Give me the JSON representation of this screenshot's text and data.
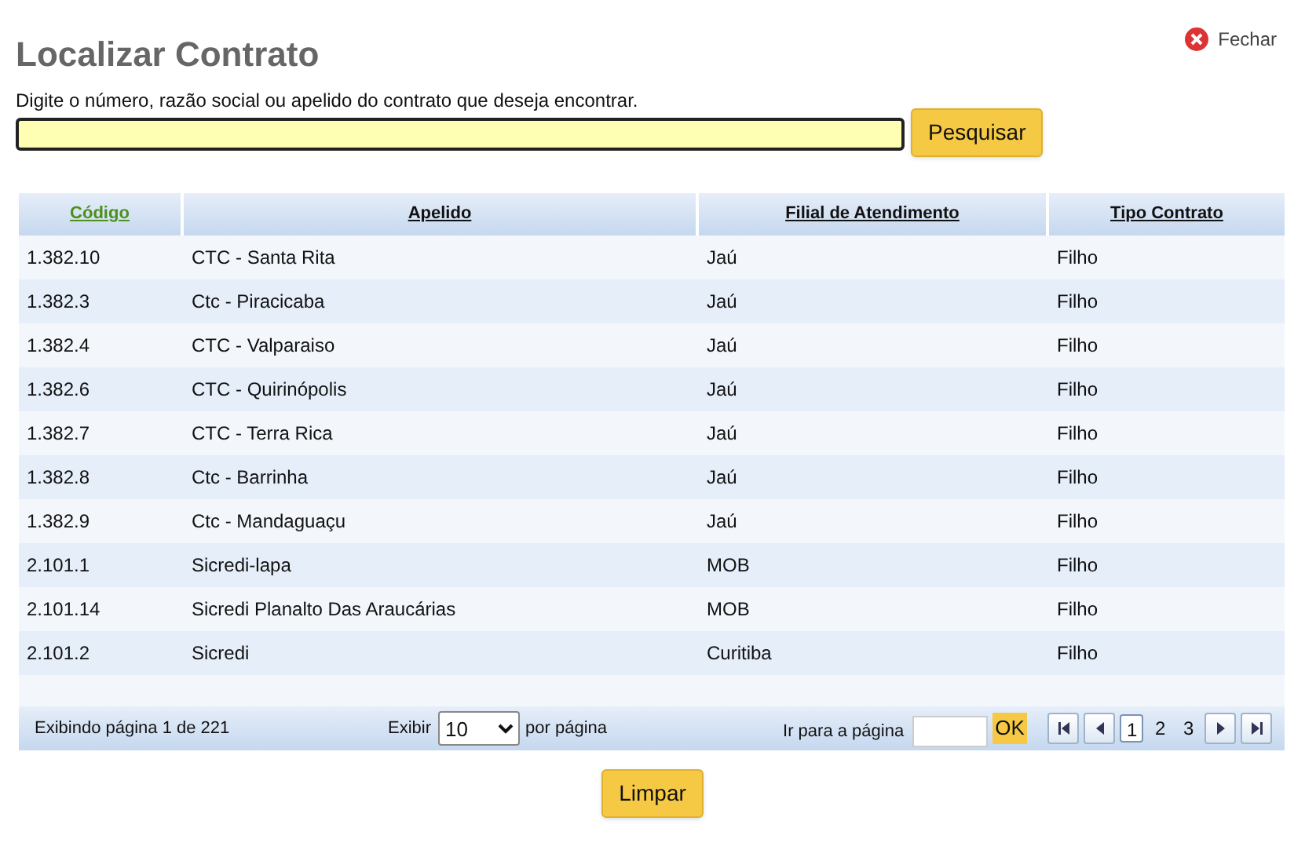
{
  "close": {
    "label": "Fechar"
  },
  "title": "Localizar Contrato",
  "search": {
    "label": "Digite o número, razão social ou apelido do contrato que deseja encontrar.",
    "button": "Pesquisar"
  },
  "table": {
    "columns": [
      {
        "label": "Código",
        "sorted": true
      },
      {
        "label": "Apelido",
        "sorted": false
      },
      {
        "label": "Filial de Atendimento",
        "sorted": false
      },
      {
        "label": "Tipo Contrato",
        "sorted": false
      }
    ],
    "rows": [
      [
        "1.382.10",
        "CTC - Santa Rita",
        "Jaú",
        "Filho"
      ],
      [
        "1.382.3",
        "Ctc - Piracicaba",
        "Jaú",
        "Filho"
      ],
      [
        "1.382.4",
        "CTC - Valparaiso",
        "Jaú",
        "Filho"
      ],
      [
        "1.382.6",
        "CTC - Quirinópolis",
        "Jaú",
        "Filho"
      ],
      [
        "1.382.7",
        "CTC - Terra Rica",
        "Jaú",
        "Filho"
      ],
      [
        "1.382.8",
        "Ctc - Barrinha",
        "Jaú",
        "Filho"
      ],
      [
        "1.382.9",
        "Ctc - Mandaguaçu",
        "Jaú",
        "Filho"
      ],
      [
        "2.101.1",
        "Sicredi-lapa",
        "MOB",
        "Filho"
      ],
      [
        "2.101.14",
        "Sicredi Planalto Das Araucárias",
        "MOB",
        "Filho"
      ],
      [
        "2.101.2",
        "Sicredi",
        "Curitiba",
        "Filho"
      ]
    ]
  },
  "pager": {
    "info": "Exibindo página 1 de 221",
    "show_label": "Exibir",
    "page_size": "10",
    "per_page": "por página",
    "goto_label": "Ir para a página",
    "ok": "OK",
    "pages": [
      {
        "label": "1",
        "selected": true
      },
      {
        "label": "2",
        "selected": false
      },
      {
        "label": "3",
        "selected": false
      }
    ]
  },
  "clear_button": "Limpar"
}
